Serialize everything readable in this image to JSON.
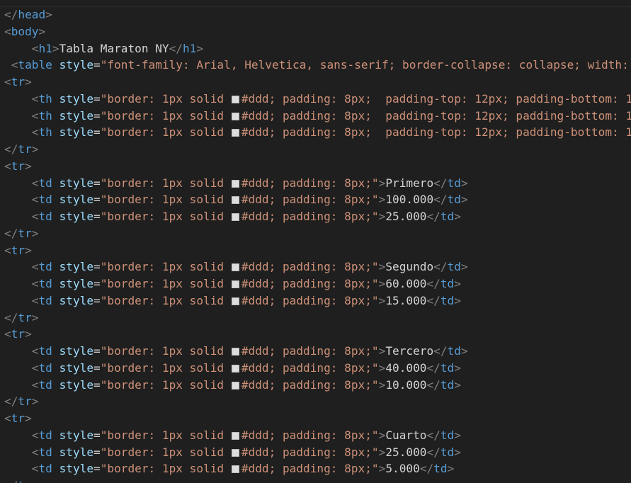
{
  "editor": {
    "background": "#1f1f1f",
    "colors": {
      "tag": "#569cd6",
      "bracket": "#808080",
      "attribute": "#9cdcfe",
      "string": "#ce9178",
      "text": "#d4d4d4",
      "swatch": "#dddddd"
    },
    "lines": [
      [
        {
          "k": "punct",
          "t": "</"
        },
        {
          "k": "tag",
          "t": "head"
        },
        {
          "k": "punct",
          "t": ">"
        }
      ],
      [
        {
          "k": "punct",
          "t": "<"
        },
        {
          "k": "tag",
          "t": "body"
        },
        {
          "k": "punct",
          "t": ">"
        }
      ],
      [
        {
          "k": "txt",
          "t": "    "
        },
        {
          "k": "punct",
          "t": "<"
        },
        {
          "k": "tag",
          "t": "h1"
        },
        {
          "k": "punct",
          "t": ">"
        },
        {
          "k": "txt",
          "t": "Tabla Maraton NY"
        },
        {
          "k": "punct",
          "t": "</"
        },
        {
          "k": "tag",
          "t": "h1"
        },
        {
          "k": "punct",
          "t": ">"
        }
      ],
      [
        {
          "k": "txt",
          "t": " "
        },
        {
          "k": "punct",
          "t": "<"
        },
        {
          "k": "tag",
          "t": "table"
        },
        {
          "k": "txt",
          "t": " "
        },
        {
          "k": "attr",
          "t": "style"
        },
        {
          "k": "eq",
          "t": "="
        },
        {
          "k": "str",
          "t": "\"font-family: Arial, Helvetica, sans-serif; border-collapse: collapse; width: "
        }
      ],
      [
        {
          "k": "punct",
          "t": "<"
        },
        {
          "k": "tag",
          "t": "tr"
        },
        {
          "k": "punct",
          "t": ">"
        }
      ],
      [
        {
          "k": "txt",
          "t": "    "
        },
        {
          "k": "punct",
          "t": "<"
        },
        {
          "k": "tag",
          "t": "th"
        },
        {
          "k": "txt",
          "t": " "
        },
        {
          "k": "attr",
          "t": "style"
        },
        {
          "k": "eq",
          "t": "="
        },
        {
          "k": "str",
          "t": "\"border: 1px solid "
        },
        {
          "k": "swatch",
          "t": "#dddddd"
        },
        {
          "k": "str",
          "t": "#ddd; padding: 8px;  padding-top: 12px; padding-bottom: 1"
        }
      ],
      [
        {
          "k": "txt",
          "t": "    "
        },
        {
          "k": "punct",
          "t": "<"
        },
        {
          "k": "tag",
          "t": "th"
        },
        {
          "k": "txt",
          "t": " "
        },
        {
          "k": "attr",
          "t": "style"
        },
        {
          "k": "eq",
          "t": "="
        },
        {
          "k": "str",
          "t": "\"border: 1px solid "
        },
        {
          "k": "swatch",
          "t": "#dddddd"
        },
        {
          "k": "str",
          "t": "#ddd; padding: 8px;  padding-top: 12px; padding-bottom: 1"
        }
      ],
      [
        {
          "k": "txt",
          "t": "    "
        },
        {
          "k": "punct",
          "t": "<"
        },
        {
          "k": "tag",
          "t": "th"
        },
        {
          "k": "txt",
          "t": " "
        },
        {
          "k": "attr",
          "t": "style"
        },
        {
          "k": "eq",
          "t": "="
        },
        {
          "k": "str",
          "t": "\"border: 1px solid "
        },
        {
          "k": "swatch",
          "t": "#dddddd"
        },
        {
          "k": "str",
          "t": "#ddd; padding: 8px;  padding-top: 12px; padding-bottom: 1"
        }
      ],
      [
        {
          "k": "punct",
          "t": "</"
        },
        {
          "k": "tag",
          "t": "tr"
        },
        {
          "k": "punct",
          "t": ">"
        }
      ],
      [
        {
          "k": "punct",
          "t": "<"
        },
        {
          "k": "tag",
          "t": "tr"
        },
        {
          "k": "punct",
          "t": ">"
        }
      ],
      [
        {
          "k": "txt",
          "t": "    "
        },
        {
          "k": "punct",
          "t": "<"
        },
        {
          "k": "tag",
          "t": "td"
        },
        {
          "k": "txt",
          "t": " "
        },
        {
          "k": "attr",
          "t": "style"
        },
        {
          "k": "eq",
          "t": "="
        },
        {
          "k": "str",
          "t": "\"border: 1px solid "
        },
        {
          "k": "swatch",
          "t": "#dddddd"
        },
        {
          "k": "str",
          "t": "#ddd; padding: 8px;\""
        },
        {
          "k": "punct",
          "t": ">"
        },
        {
          "k": "txt",
          "t": "Primero"
        },
        {
          "k": "punct",
          "t": "</"
        },
        {
          "k": "tag",
          "t": "td"
        },
        {
          "k": "punct",
          "t": ">"
        }
      ],
      [
        {
          "k": "txt",
          "t": "    "
        },
        {
          "k": "punct",
          "t": "<"
        },
        {
          "k": "tag",
          "t": "td"
        },
        {
          "k": "txt",
          "t": " "
        },
        {
          "k": "attr",
          "t": "style"
        },
        {
          "k": "eq",
          "t": "="
        },
        {
          "k": "str",
          "t": "\"border: 1px solid "
        },
        {
          "k": "swatch",
          "t": "#dddddd"
        },
        {
          "k": "str",
          "t": "#ddd; padding: 8px;\""
        },
        {
          "k": "punct",
          "t": ">"
        },
        {
          "k": "txt",
          "t": "100.000"
        },
        {
          "k": "punct",
          "t": "</"
        },
        {
          "k": "tag",
          "t": "td"
        },
        {
          "k": "punct",
          "t": ">"
        }
      ],
      [
        {
          "k": "txt",
          "t": "    "
        },
        {
          "k": "punct",
          "t": "<"
        },
        {
          "k": "tag",
          "t": "td"
        },
        {
          "k": "txt",
          "t": " "
        },
        {
          "k": "attr",
          "t": "style"
        },
        {
          "k": "eq",
          "t": "="
        },
        {
          "k": "str",
          "t": "\"border: 1px solid "
        },
        {
          "k": "swatch",
          "t": "#dddddd"
        },
        {
          "k": "str",
          "t": "#ddd; padding: 8px;\""
        },
        {
          "k": "punct",
          "t": ">"
        },
        {
          "k": "txt",
          "t": "25.000"
        },
        {
          "k": "punct",
          "t": "</"
        },
        {
          "k": "tag",
          "t": "td"
        },
        {
          "k": "punct",
          "t": ">"
        }
      ],
      [
        {
          "k": "punct",
          "t": "</"
        },
        {
          "k": "tag",
          "t": "tr"
        },
        {
          "k": "punct",
          "t": ">"
        }
      ],
      [
        {
          "k": "punct",
          "t": "<"
        },
        {
          "k": "tag",
          "t": "tr"
        },
        {
          "k": "punct",
          "t": ">"
        }
      ],
      [
        {
          "k": "txt",
          "t": "    "
        },
        {
          "k": "punct",
          "t": "<"
        },
        {
          "k": "tag",
          "t": "td"
        },
        {
          "k": "txt",
          "t": " "
        },
        {
          "k": "attr",
          "t": "style"
        },
        {
          "k": "eq",
          "t": "="
        },
        {
          "k": "str",
          "t": "\"border: 1px solid "
        },
        {
          "k": "swatch",
          "t": "#dddddd"
        },
        {
          "k": "str",
          "t": "#ddd; padding: 8px;\""
        },
        {
          "k": "punct",
          "t": ">"
        },
        {
          "k": "txt",
          "t": "Segundo"
        },
        {
          "k": "punct",
          "t": "</"
        },
        {
          "k": "tag",
          "t": "td"
        },
        {
          "k": "punct",
          "t": ">"
        }
      ],
      [
        {
          "k": "txt",
          "t": "    "
        },
        {
          "k": "punct",
          "t": "<"
        },
        {
          "k": "tag",
          "t": "td"
        },
        {
          "k": "txt",
          "t": " "
        },
        {
          "k": "attr",
          "t": "style"
        },
        {
          "k": "eq",
          "t": "="
        },
        {
          "k": "str",
          "t": "\"border: 1px solid "
        },
        {
          "k": "swatch",
          "t": "#dddddd"
        },
        {
          "k": "str",
          "t": "#ddd; padding: 8px;\""
        },
        {
          "k": "punct",
          "t": ">"
        },
        {
          "k": "txt",
          "t": "60.000"
        },
        {
          "k": "punct",
          "t": "</"
        },
        {
          "k": "tag",
          "t": "td"
        },
        {
          "k": "punct",
          "t": ">"
        }
      ],
      [
        {
          "k": "txt",
          "t": "    "
        },
        {
          "k": "punct",
          "t": "<"
        },
        {
          "k": "tag",
          "t": "td"
        },
        {
          "k": "txt",
          "t": " "
        },
        {
          "k": "attr",
          "t": "style"
        },
        {
          "k": "eq",
          "t": "="
        },
        {
          "k": "str",
          "t": "\"border: 1px solid "
        },
        {
          "k": "swatch",
          "t": "#dddddd"
        },
        {
          "k": "str",
          "t": "#ddd; padding: 8px;\""
        },
        {
          "k": "punct",
          "t": ">"
        },
        {
          "k": "txt",
          "t": "15.000"
        },
        {
          "k": "punct",
          "t": "</"
        },
        {
          "k": "tag",
          "t": "td"
        },
        {
          "k": "punct",
          "t": ">"
        }
      ],
      [
        {
          "k": "punct",
          "t": "</"
        },
        {
          "k": "tag",
          "t": "tr"
        },
        {
          "k": "punct",
          "t": ">"
        }
      ],
      [
        {
          "k": "punct",
          "t": "<"
        },
        {
          "k": "tag",
          "t": "tr"
        },
        {
          "k": "punct",
          "t": ">"
        }
      ],
      [
        {
          "k": "txt",
          "t": "    "
        },
        {
          "k": "punct",
          "t": "<"
        },
        {
          "k": "tag",
          "t": "td"
        },
        {
          "k": "txt",
          "t": " "
        },
        {
          "k": "attr",
          "t": "style"
        },
        {
          "k": "eq",
          "t": "="
        },
        {
          "k": "str",
          "t": "\"border: 1px solid "
        },
        {
          "k": "swatch",
          "t": "#dddddd"
        },
        {
          "k": "str",
          "t": "#ddd; padding: 8px;\""
        },
        {
          "k": "punct",
          "t": ">"
        },
        {
          "k": "txt",
          "t": "Tercero"
        },
        {
          "k": "punct",
          "t": "</"
        },
        {
          "k": "tag",
          "t": "td"
        },
        {
          "k": "punct",
          "t": ">"
        }
      ],
      [
        {
          "k": "txt",
          "t": "    "
        },
        {
          "k": "punct",
          "t": "<"
        },
        {
          "k": "tag",
          "t": "td"
        },
        {
          "k": "txt",
          "t": " "
        },
        {
          "k": "attr",
          "t": "style"
        },
        {
          "k": "eq",
          "t": "="
        },
        {
          "k": "str",
          "t": "\"border: 1px solid "
        },
        {
          "k": "swatch",
          "t": "#dddddd"
        },
        {
          "k": "str",
          "t": "#ddd; padding: 8px;\""
        },
        {
          "k": "punct",
          "t": ">"
        },
        {
          "k": "txt",
          "t": "40.000"
        },
        {
          "k": "punct",
          "t": "</"
        },
        {
          "k": "tag",
          "t": "td"
        },
        {
          "k": "punct",
          "t": ">"
        }
      ],
      [
        {
          "k": "txt",
          "t": "    "
        },
        {
          "k": "punct",
          "t": "<"
        },
        {
          "k": "tag",
          "t": "td"
        },
        {
          "k": "txt",
          "t": " "
        },
        {
          "k": "attr",
          "t": "style"
        },
        {
          "k": "eq",
          "t": "="
        },
        {
          "k": "str",
          "t": "\"border: 1px solid "
        },
        {
          "k": "swatch",
          "t": "#dddddd"
        },
        {
          "k": "str",
          "t": "#ddd; padding: 8px;\""
        },
        {
          "k": "punct",
          "t": ">"
        },
        {
          "k": "txt",
          "t": "10.000"
        },
        {
          "k": "punct",
          "t": "</"
        },
        {
          "k": "tag",
          "t": "td"
        },
        {
          "k": "punct",
          "t": ">"
        }
      ],
      [
        {
          "k": "punct",
          "t": "</"
        },
        {
          "k": "tag",
          "t": "tr"
        },
        {
          "k": "punct",
          "t": ">"
        }
      ],
      [
        {
          "k": "punct",
          "t": "<"
        },
        {
          "k": "tag",
          "t": "tr"
        },
        {
          "k": "punct",
          "t": ">"
        }
      ],
      [
        {
          "k": "txt",
          "t": "    "
        },
        {
          "k": "punct",
          "t": "<"
        },
        {
          "k": "tag",
          "t": "td"
        },
        {
          "k": "txt",
          "t": " "
        },
        {
          "k": "attr",
          "t": "style"
        },
        {
          "k": "eq",
          "t": "="
        },
        {
          "k": "str",
          "t": "\"border: 1px solid "
        },
        {
          "k": "swatch",
          "t": "#dddddd"
        },
        {
          "k": "str",
          "t": "#ddd; padding: 8px;\""
        },
        {
          "k": "punct",
          "t": ">"
        },
        {
          "k": "txt",
          "t": "Cuarto"
        },
        {
          "k": "punct",
          "t": "</"
        },
        {
          "k": "tag",
          "t": "td"
        },
        {
          "k": "punct",
          "t": ">"
        }
      ],
      [
        {
          "k": "txt",
          "t": "    "
        },
        {
          "k": "punct",
          "t": "<"
        },
        {
          "k": "tag",
          "t": "td"
        },
        {
          "k": "txt",
          "t": " "
        },
        {
          "k": "attr",
          "t": "style"
        },
        {
          "k": "eq",
          "t": "="
        },
        {
          "k": "str",
          "t": "\"border: 1px solid "
        },
        {
          "k": "swatch",
          "t": "#dddddd"
        },
        {
          "k": "str",
          "t": "#ddd; padding: 8px;\""
        },
        {
          "k": "punct",
          "t": ">"
        },
        {
          "k": "txt",
          "t": "25.000"
        },
        {
          "k": "punct",
          "t": "</"
        },
        {
          "k": "tag",
          "t": "td"
        },
        {
          "k": "punct",
          "t": ">"
        }
      ],
      [
        {
          "k": "txt",
          "t": "    "
        },
        {
          "k": "punct",
          "t": "<"
        },
        {
          "k": "tag",
          "t": "td"
        },
        {
          "k": "txt",
          "t": " "
        },
        {
          "k": "attr",
          "t": "style"
        },
        {
          "k": "eq",
          "t": "="
        },
        {
          "k": "str",
          "t": "\"border: 1px solid "
        },
        {
          "k": "swatch",
          "t": "#dddddd"
        },
        {
          "k": "str",
          "t": "#ddd; padding: 8px;\""
        },
        {
          "k": "punct",
          "t": ">"
        },
        {
          "k": "txt",
          "t": "5.000"
        },
        {
          "k": "punct",
          "t": "</"
        },
        {
          "k": "tag",
          "t": "td"
        },
        {
          "k": "punct",
          "t": ">"
        }
      ],
      [
        {
          "k": "punct",
          "t": "</"
        },
        {
          "k": "tag",
          "t": "tr"
        },
        {
          "k": "punct",
          "t": ">"
        }
      ]
    ]
  }
}
